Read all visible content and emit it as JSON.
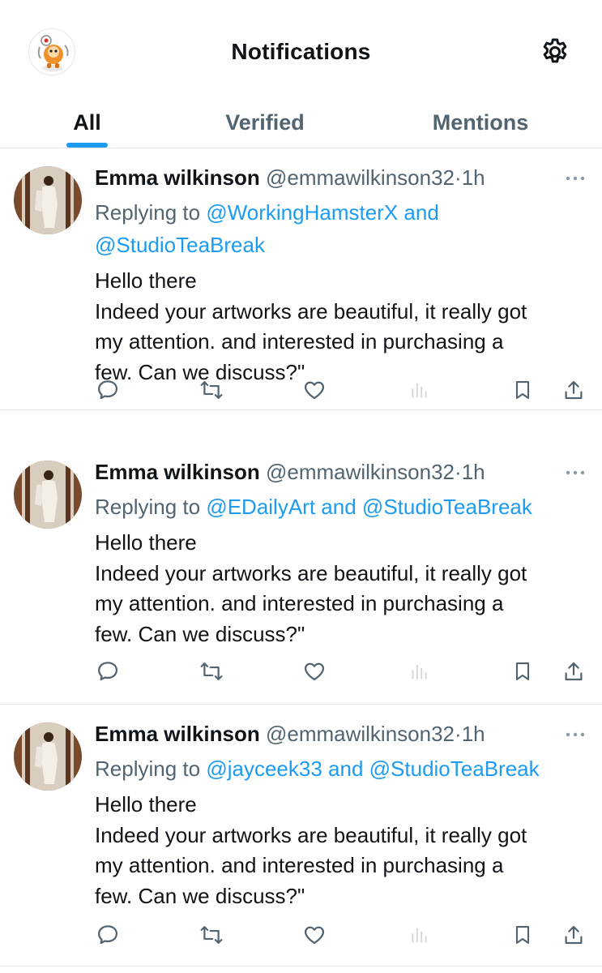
{
  "header": {
    "title": "Notifications",
    "avatar_icon": "astronaut-mascot-avatar",
    "settings_icon": "gear-icon"
  },
  "tabs": [
    {
      "label": "All",
      "active": true
    },
    {
      "label": "Verified",
      "active": false
    },
    {
      "label": "Mentions",
      "active": false
    }
  ],
  "colors": {
    "accent": "#1d9bf0",
    "text": "#0f1419",
    "secondary": "#536471",
    "divider": "#e1e6ea"
  },
  "tweets": [
    {
      "name": "Emma wilkinson",
      "handle": "@emmawilkinson32",
      "dot": "·",
      "time": "1h",
      "replying_prefix": "Replying to",
      "mention1": "@WorkingHamsterX",
      "and": "and",
      "mention2": "@StudioTeaBreak",
      "body": [
        "Hello there",
        "Indeed your artworks are beautiful, it really got",
        "my attention. and interested in purchasing a",
        "few. Can we discuss?\""
      ]
    },
    {
      "name": "Emma wilkinson",
      "handle": "@emmawilkinson32",
      "dot": "·",
      "time": "1h",
      "replying_prefix": "Replying to",
      "mention1": "@EDailyArt",
      "and": "and",
      "mention2": "@StudioTeaBreak",
      "body": [
        "Hello there",
        "Indeed your artworks are beautiful, it really got",
        "my attention. and interested in purchasing a",
        "few. Can we discuss?\""
      ]
    },
    {
      "name": "Emma wilkinson",
      "handle": "@emmawilkinson32",
      "dot": "·",
      "time": "1h",
      "replying_prefix": "Replying to",
      "mention1": "@jayceek33",
      "and": "and",
      "mention2": "@StudioTeaBreak",
      "body": [
        "Hello there",
        "Indeed your artworks are beautiful, it really got",
        "my attention. and interested in purchasing a",
        "few. Can we discuss?\""
      ]
    }
  ],
  "action_icons": [
    "reply-icon",
    "retweet-icon",
    "like-icon",
    "views-icon",
    "bookmark-icon",
    "share-icon"
  ]
}
